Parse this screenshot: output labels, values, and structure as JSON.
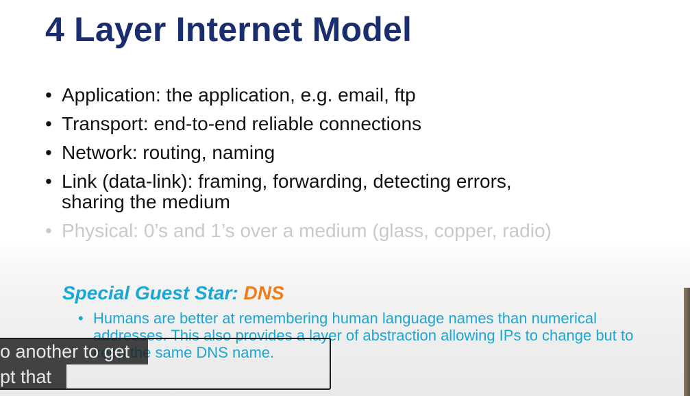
{
  "slide": {
    "title": "4 Layer Internet Model",
    "bullets": [
      {
        "text": "Application: the application, e.g. email, ftp"
      },
      {
        "text": "Transport: end-to-end reliable connections"
      },
      {
        "text": "Network: routing, naming"
      },
      {
        "text": "Link (data-link): framing, forwarding, detecting errors,",
        "text2": "sharing the medium"
      },
      {
        "text": "Physical: 0’s and 1’s over a medium (glass, copper, radio)"
      }
    ],
    "guest_label": "Special Guest Star: ",
    "guest_dns": "DNS",
    "guest_sub": "Humans are better at remembering human language names than numerical addresses. This also provides a layer of abstraction allowing IPs to change but to keep the same DNS name."
  },
  "captions": {
    "line1": "o another to get",
    "line2": "pt that"
  },
  "colors": {
    "title": "#1a2e6e",
    "guest_label": "#1ba6d4",
    "guest_dns": "#ef7d1a",
    "faded_bullet": "#c9c9c9"
  }
}
